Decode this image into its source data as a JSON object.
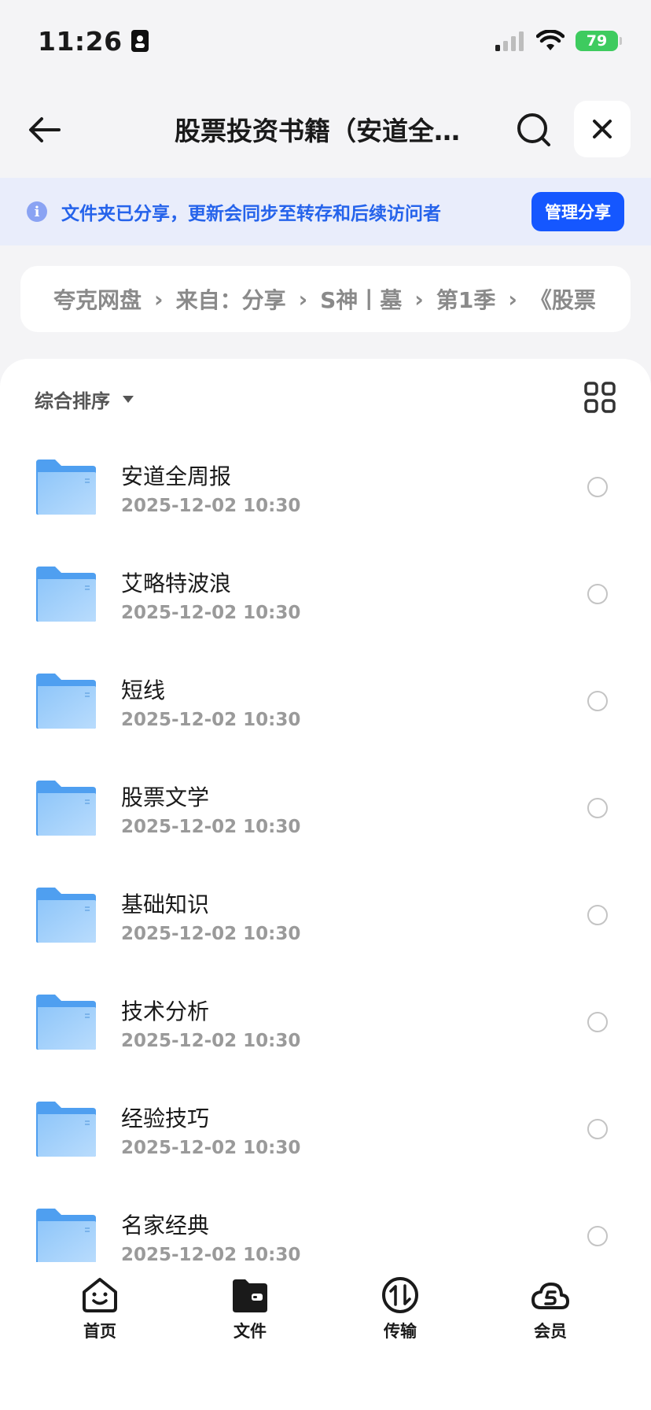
{
  "status_bar": {
    "time": "11:26",
    "battery": "79",
    "icons": [
      "id-card-icon",
      "cellular-signal-icon",
      "wifi-icon",
      "battery-charging-icon"
    ]
  },
  "header": {
    "title": "股票投资书籍（安道全…",
    "icons": [
      "back-arrow-icon",
      "search-icon",
      "close-icon"
    ]
  },
  "share_banner": {
    "text": "文件夹已分享，更新会同步至转存和后续访问者",
    "manage_label": "管理分享",
    "accent": "#1557ff"
  },
  "breadcrumb": {
    "items": [
      "夸克网盘",
      "来自：分享",
      "S神丨墓",
      "第1季",
      "《股票"
    ],
    "separator": "›"
  },
  "sort": {
    "label": "综合排序"
  },
  "files": [
    {
      "name": "安道全周报",
      "date": "2025-12-02 10:30"
    },
    {
      "name": "艾略特波浪",
      "date": "2025-12-02 10:30"
    },
    {
      "name": "短线",
      "date": "2025-12-02 10:30"
    },
    {
      "name": "股票文学",
      "date": "2025-12-02 10:30"
    },
    {
      "name": "基础知识",
      "date": "2025-12-02 10:30"
    },
    {
      "name": "技术分析",
      "date": "2025-12-02 10:30"
    },
    {
      "name": "经验技巧",
      "date": "2025-12-02 10:30"
    },
    {
      "name": "名家经典",
      "date": "2025-12-02 10:30"
    }
  ],
  "nav": {
    "items": [
      {
        "label": "首页",
        "icon": "home-smile-icon"
      },
      {
        "label": "文件",
        "icon": "folder-wallet-icon"
      },
      {
        "label": "传输",
        "icon": "transfer-icon"
      },
      {
        "label": "会员",
        "icon": "vip-cloud-icon"
      }
    ]
  }
}
